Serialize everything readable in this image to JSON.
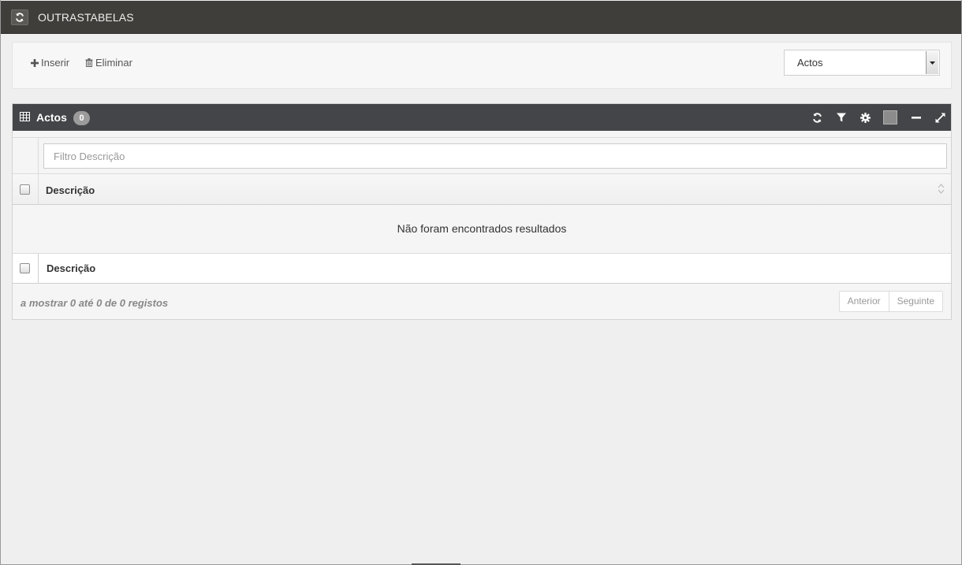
{
  "topbar": {
    "title": "OUTRASTABELAS",
    "refresh_icon": "refresh-icon"
  },
  "toolbar": {
    "insert_label": "Inserir",
    "delete_label": "Eliminar",
    "table_select": {
      "selected": "Actos"
    }
  },
  "grid": {
    "title": "Actos",
    "count": "0",
    "header_icons": [
      "refresh-icon",
      "filter-icon",
      "gear-icon",
      "square-icon",
      "minimize-icon",
      "expand-icon"
    ],
    "filter_placeholder": "Filtro Descrição",
    "column_header": "Descrição",
    "empty_message": "Não foram encontrados resultados",
    "column_footer": "Descrição",
    "paging_info": "a mostrar 0 até 0 de 0 registos",
    "prev_label": "Anterior",
    "next_label": "Seguinte"
  },
  "colors": {
    "topbar_bg": "#403e3b",
    "widget_header_bg": "#444548",
    "page_bg": "#efefef"
  }
}
